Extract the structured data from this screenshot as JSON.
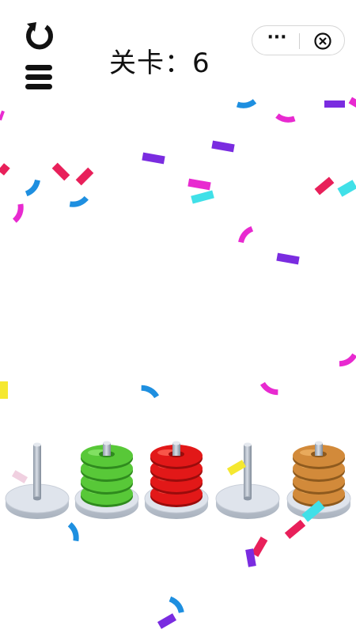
{
  "header": {
    "level_text": "关卡：6",
    "menu_more_glyph": "···",
    "restart_icon": "restart-icon",
    "menu_icon": "hamburger-menu-icon",
    "close_icon": "close-circle-icon"
  },
  "pegs": [
    {
      "name": "peg-1",
      "rings": 0,
      "color": null
    },
    {
      "name": "peg-2",
      "rings": 4,
      "color": "green"
    },
    {
      "name": "peg-3",
      "rings": 4,
      "color": "red"
    },
    {
      "name": "peg-4",
      "rings": 0,
      "color": null
    },
    {
      "name": "peg-5",
      "rings": 4,
      "color": "orange"
    }
  ],
  "colors": {
    "green": {
      "main": "#58c838",
      "light": "#8fe870",
      "dark": "#2f8a1e"
    },
    "red": {
      "main": "#e21818",
      "light": "#ff6a5a",
      "dark": "#9a0c0c"
    },
    "orange": {
      "main": "#d28a3a",
      "light": "#f0b468",
      "dark": "#8e5a1e"
    },
    "base": "#dfe4ec",
    "pole": "#aab4c0",
    "confetti_blue": "#1e8fe0",
    "confetti_magenta": "#e82ad0",
    "confetti_purple": "#7a2ce0",
    "confetti_crimson": "#e8205a",
    "confetti_cyan": "#40e0e8",
    "confetti_yellow": "#f5e830"
  }
}
